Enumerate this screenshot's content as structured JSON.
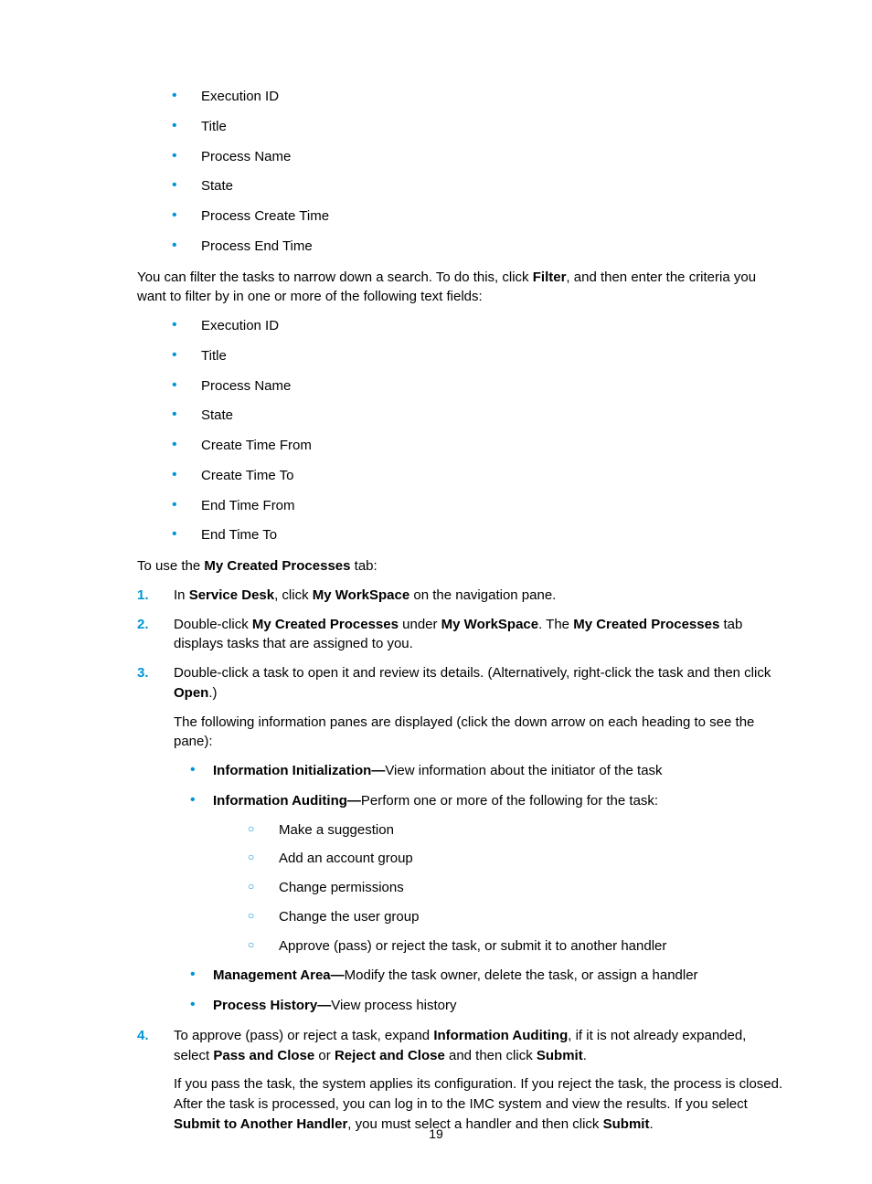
{
  "pageNumber": "19",
  "list1": [
    "Execution ID",
    "Title",
    "Process Name",
    "State",
    "Process Create Time",
    "Process End Time"
  ],
  "para1": {
    "t0": "You can filter the tasks to narrow down a search. To do this, click ",
    "b0": "Filter",
    "t1": ", and then enter the criteria you want to filter by in one or more of the following text fields:"
  },
  "list2": [
    "Execution ID",
    "Title",
    "Process Name",
    "State",
    "Create Time From",
    "Create Time To",
    "End Time From",
    "End Time To"
  ],
  "para2": {
    "t0": "To use the ",
    "b0": "My Created Processes",
    "t1": " tab:"
  },
  "step1": {
    "num": "1.",
    "t0": "In ",
    "b0": "Service Desk",
    "t1": ", click ",
    "b1": "My WorkSpace",
    "t2": " on the navigation pane."
  },
  "step2": {
    "num": "2.",
    "t0": "Double-click ",
    "b0": "My Created Processes",
    "t1": " under ",
    "b1": "My WorkSpace",
    "t2": ". The ",
    "b2": "My Created Processes",
    "t3": " tab displays tasks that are assigned to you."
  },
  "step3": {
    "num": "3.",
    "t0": "Double-click a task to open it and review its details. (Alternatively, right-click the task and then click ",
    "b0": "Open",
    "t1": ".)"
  },
  "step3b": "The following information panes are displayed (click the down arrow on each heading to see the pane):",
  "panes": {
    "p0b": "Information Initialization—",
    "p0t": "View information about the initiator of the task",
    "p1b": "Information Auditing—",
    "p1t": "Perform one or more of the following  for the task:",
    "p2b": "Management Area—",
    "p2t": "Modify the task owner, delete the task, or assign a handler",
    "p3b": "Process History—",
    "p3t": "View process history"
  },
  "audit": [
    "Make a suggestion",
    "Add an account group",
    "Change permissions",
    "Change the user group",
    "Approve (pass) or reject the task, or submit it to another handler"
  ],
  "step4": {
    "num": "4.",
    "t0": "To approve (pass) or reject a task, expand ",
    "b0": "Information Auditing",
    "t1": ", if it is not already expanded, select ",
    "b1": "Pass and Close",
    "t2": " or ",
    "b2": "Reject and Close",
    "t3": " and then click ",
    "b3": "Submit",
    "t4": "."
  },
  "step4b": {
    "t0": "If you pass the task, the system applies its configuration. If you reject the task, the process is closed. After the task is processed, you can log in to the IMC system and view the results. If you select ",
    "b0": "Submit to Another Handler",
    "t1": ", you must select a handler and then click ",
    "b1": "Submit",
    "t2": "."
  }
}
